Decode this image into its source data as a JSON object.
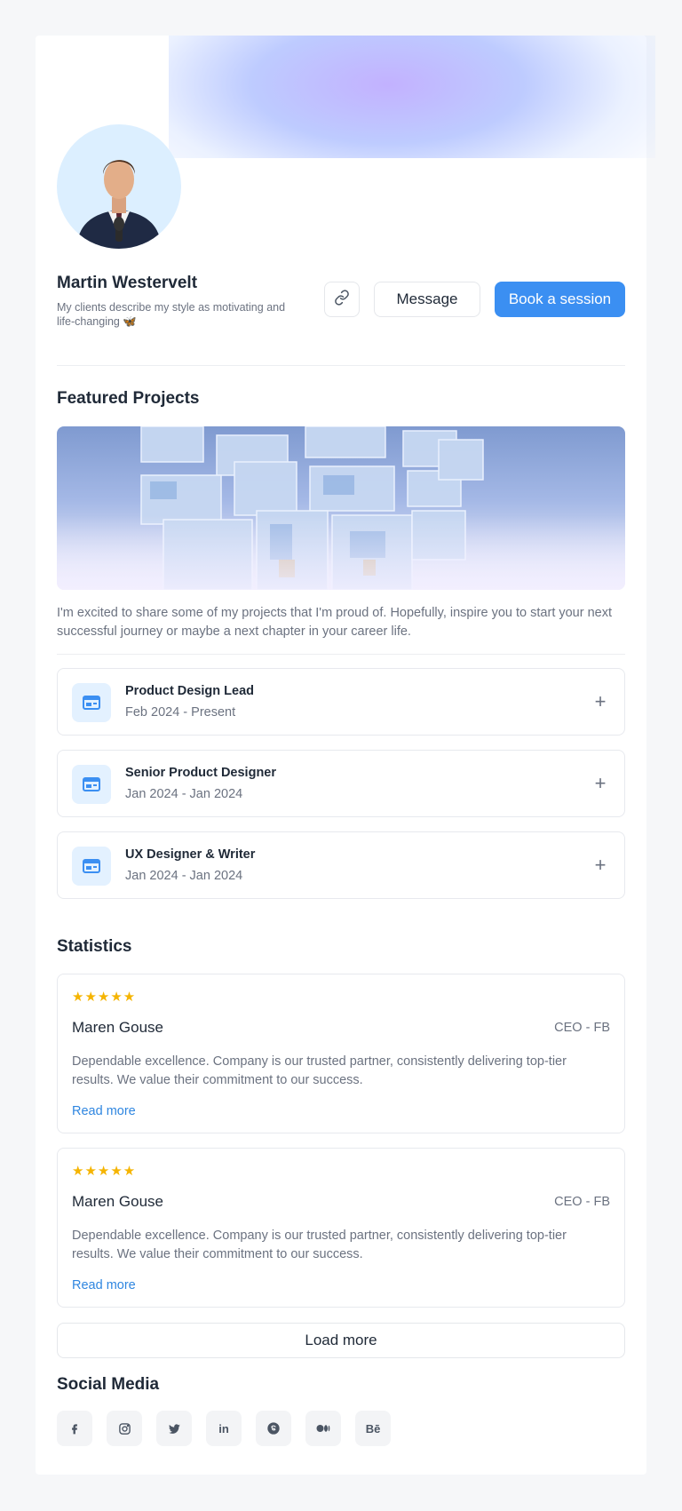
{
  "profile": {
    "name": "Martin Westervelt",
    "bio": "My clients describe my style as motivating and life-changing 🦋",
    "message_label": "Message",
    "book_label": "Book a session"
  },
  "projects": {
    "heading": "Featured Projects",
    "intro": "I'm excited to share some of my projects that I'm proud of. Hopefully, inspire you to start your next successful journey or maybe a next chapter in your career life.",
    "jobs": [
      {
        "title": "Product Design Lead",
        "dates": "Feb 2024 - Present"
      },
      {
        "title": "Senior Product Designer",
        "dates": "Jan 2024 - Jan 2024"
      },
      {
        "title": "UX Designer & Writer",
        "dates": "Jan 2024 - Jan 2024"
      }
    ]
  },
  "statistics": {
    "heading": "Statistics",
    "reviews": [
      {
        "stars": "★★★★★",
        "name": "Maren Gouse",
        "role": "CEO - FB",
        "text": "Dependable excellence. Company is our trusted partner, consistently delivering top-tier results. We value their commitment to our success.",
        "more": "Read more"
      },
      {
        "stars": "★★★★★",
        "name": "Maren Gouse",
        "role": "CEO - FB",
        "text": "Dependable excellence. Company is our trusted partner, consistently delivering top-tier results. We value their commitment to our success.",
        "more": "Read more"
      }
    ],
    "load_more": "Load more"
  },
  "social": {
    "heading": "Social Media",
    "icons": [
      "facebook-icon",
      "instagram-icon",
      "twitter-icon",
      "linkedin-icon",
      "skype-icon",
      "medium-icon",
      "behance-icon"
    ],
    "linkedin_glyph": "in",
    "behance_glyph": "Bē"
  },
  "colors": {
    "accent": "#3b8ff2",
    "star": "#f5b400",
    "link": "#2f86e0"
  }
}
